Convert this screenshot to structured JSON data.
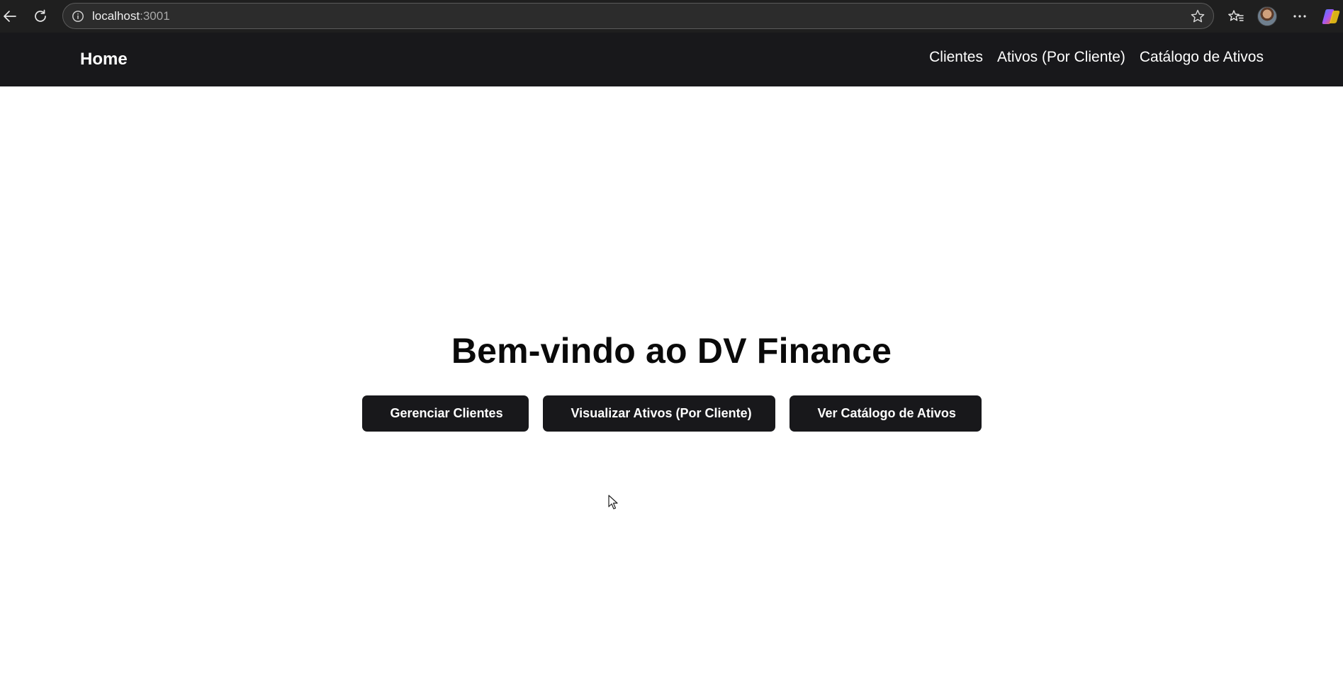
{
  "browser": {
    "url_host": "localhost",
    "url_port": ":3001",
    "icons": {
      "back": "arrow-left-icon",
      "reload": "reload-icon",
      "site_info": "info-icon",
      "favorite": "star-icon",
      "favorites": "favorites-list-icon",
      "more": "ellipsis-icon",
      "copilot": "copilot-icon"
    }
  },
  "navbar": {
    "home_label": "Home",
    "links": [
      {
        "label": "Clientes"
      },
      {
        "label": "Ativos (Por Cliente)"
      },
      {
        "label": "Catálogo de Ativos"
      }
    ],
    "background_color": "#18181b"
  },
  "main": {
    "title": "Bem-vindo ao DV Finance",
    "buttons": [
      {
        "label": "Gerenciar Clientes"
      },
      {
        "label": "Visualizar Ativos (Por Cliente)"
      },
      {
        "label": "Ver Catálogo de Ativos"
      }
    ],
    "button_color": "#18181b"
  }
}
